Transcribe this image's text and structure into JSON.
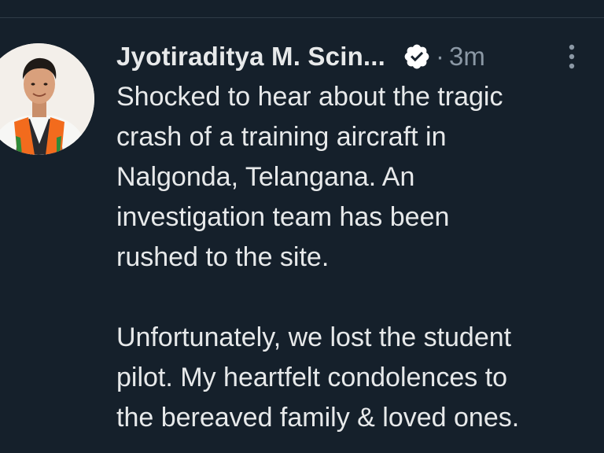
{
  "tweet": {
    "author": {
      "display_name": "Jyotiraditya M. Scin...",
      "verified": true,
      "avatar_icon": "profile-photo"
    },
    "separator": "·",
    "timestamp": "3m",
    "more_icon": "more-options-icon",
    "paragraphs": [
      "Shocked to hear about the tragic\ncrash of a training aircraft in\nNalgonda, Telangana. An\ninvestigation team has been\nrushed to the site.",
      "Unfortunately, we lost the student\npilot. My heartfelt condolences to\nthe bereaved family & loved ones."
    ]
  },
  "colors": {
    "background": "#15202b",
    "text_primary": "#e7e9ea",
    "text_secondary": "#8b98a5",
    "verified_badge": "#ffffff"
  }
}
